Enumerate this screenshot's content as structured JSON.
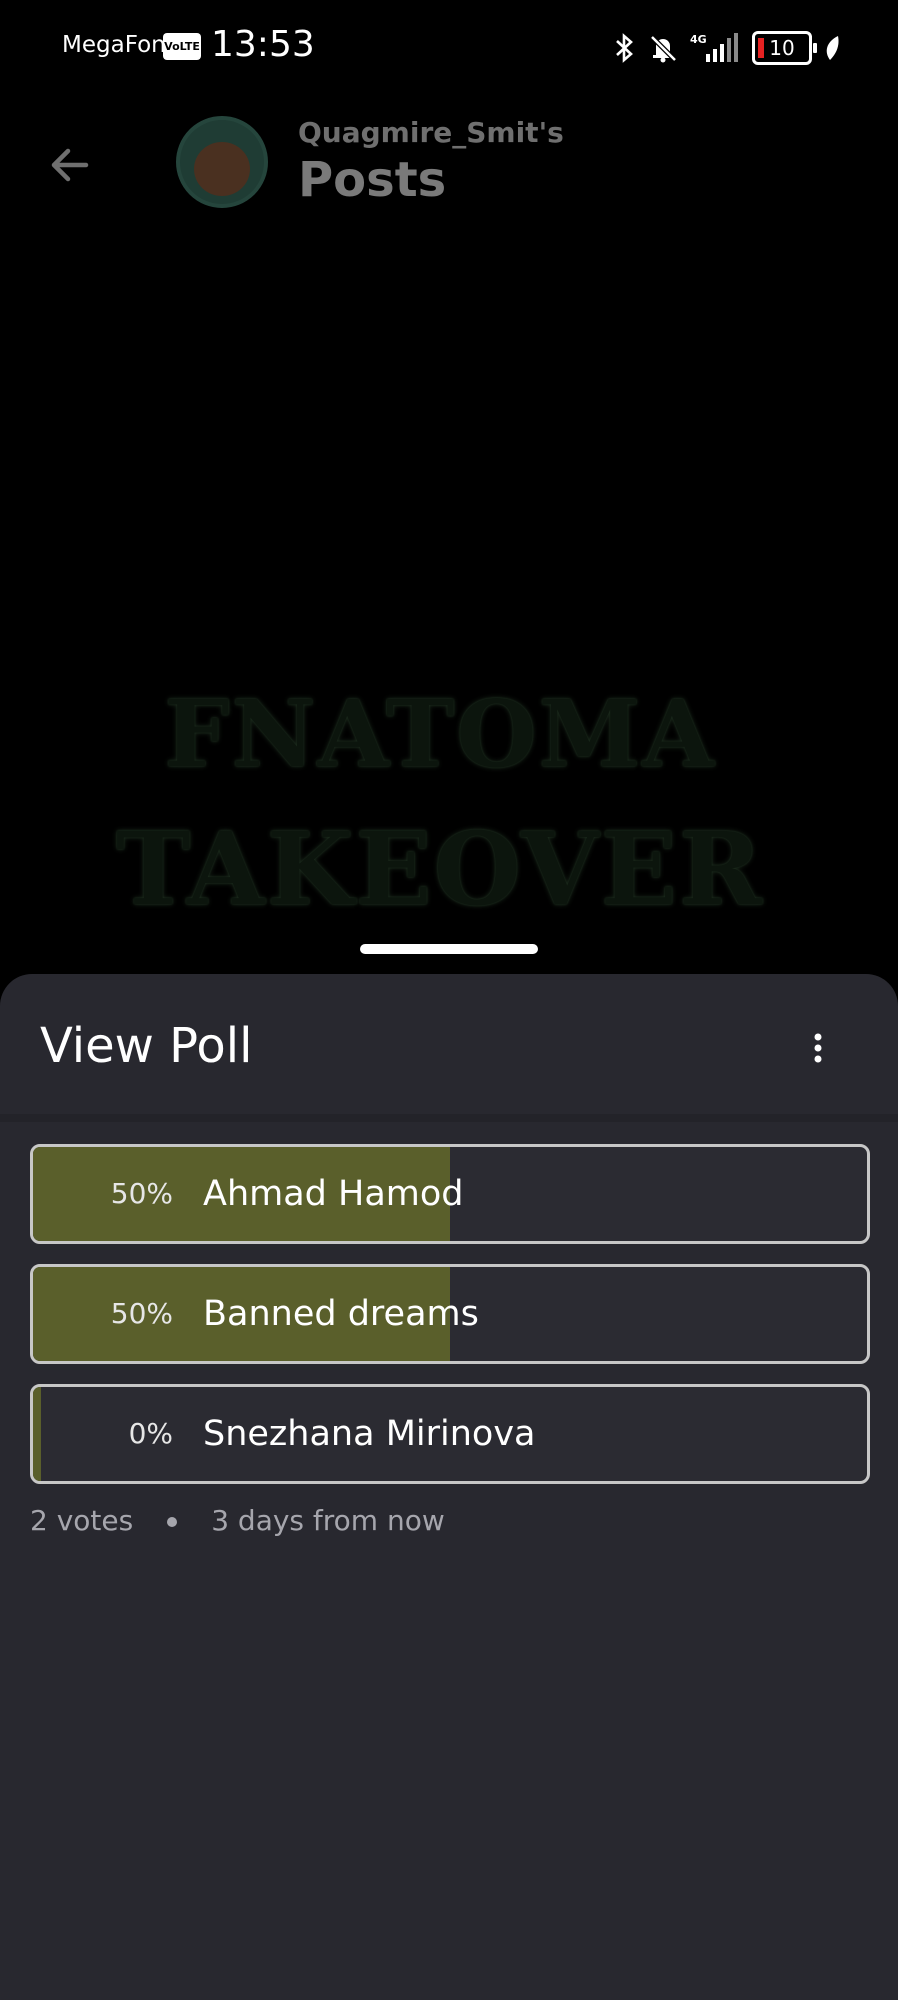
{
  "status_bar": {
    "carrier": "MegaFon",
    "volte": "VoLTE",
    "time": "13:53",
    "network": "4G",
    "battery": "10"
  },
  "header": {
    "subtitle": "Quagmire_Smit's",
    "title": "Posts"
  },
  "post_image_text": {
    "line1": "FNATOMA",
    "line2": "TAKEOVER"
  },
  "sheet": {
    "title": "View Poll",
    "options": [
      {
        "percent_label": "50%",
        "name": "Ahmad Hamod",
        "share": 0.5
      },
      {
        "percent_label": "50%",
        "name": "Banned dreams",
        "share": 0.5
      },
      {
        "percent_label": "0%",
        "name": "Snezhana Mirinova",
        "share": 0.0
      }
    ],
    "votes": "2 votes",
    "deadline": "3 days from now"
  },
  "colors": {
    "sheet_bg": "#28282f",
    "bar_fill": "#5a5f2b",
    "option_border": "#c7c7c7"
  }
}
